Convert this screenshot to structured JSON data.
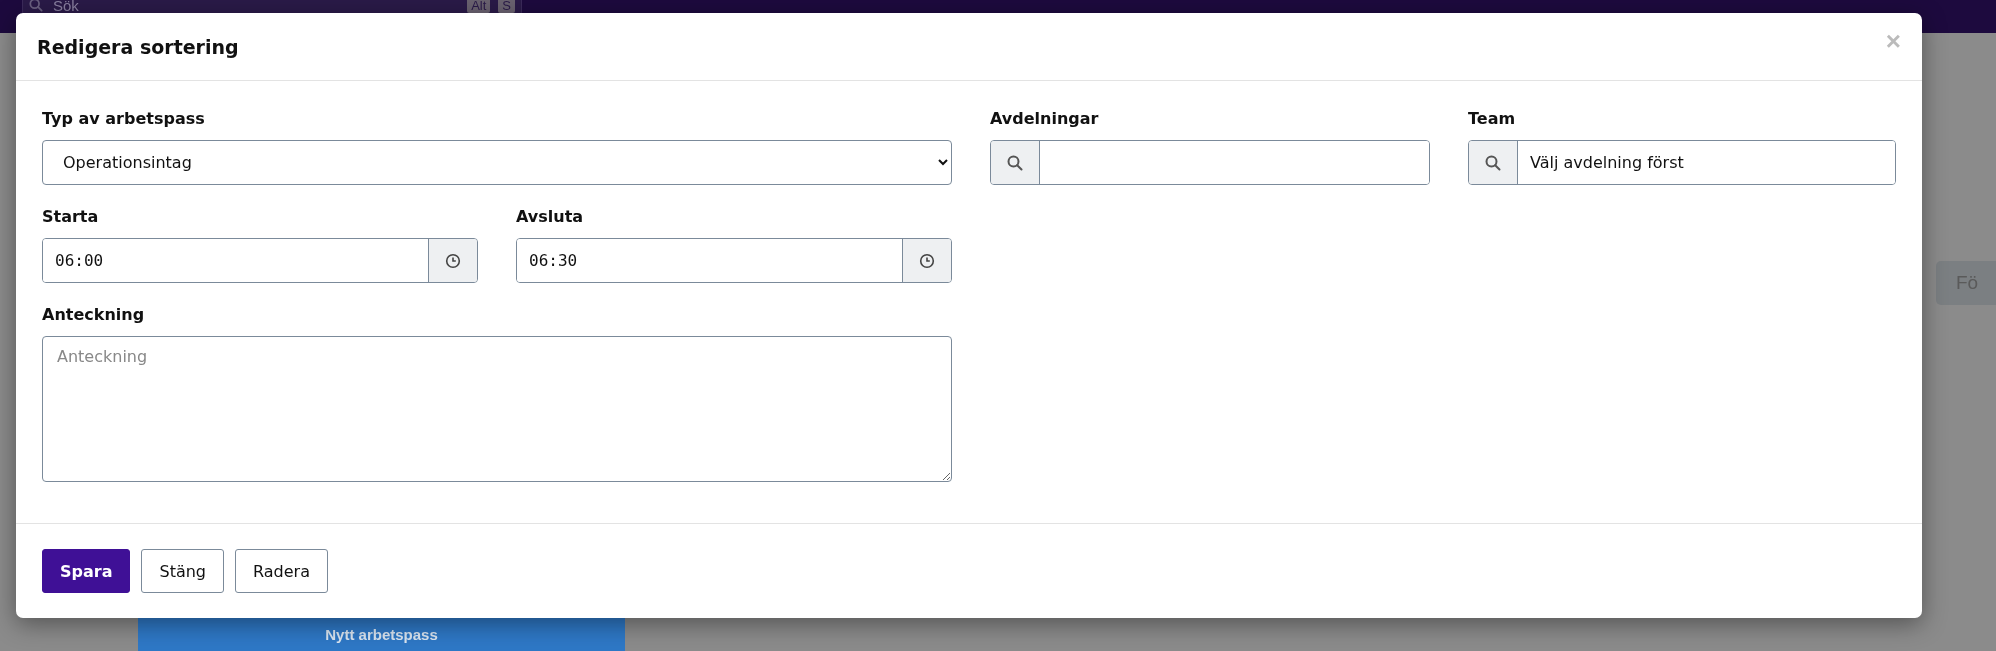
{
  "topbar": {
    "search": {
      "placeholder": "Sök"
    },
    "shortcut_keys": [
      "Alt",
      "S"
    ]
  },
  "background": {
    "side_button": "Fö",
    "shift_block": "Nytt arbetspass"
  },
  "modal": {
    "title": "Redigera sortering",
    "close": "×",
    "shift_type": {
      "label": "Typ av arbetspass",
      "value": "Operationsintag"
    },
    "departments": {
      "label": "Avdelningar"
    },
    "team": {
      "label": "Team",
      "value": "Välj avdelning först"
    },
    "start": {
      "label": "Starta",
      "value": "06:00"
    },
    "end": {
      "label": "Avsluta",
      "value": "06:30"
    },
    "note": {
      "label": "Anteckning",
      "placeholder": "Anteckning"
    },
    "buttons": [
      {
        "label": "Spara",
        "kind": "primary"
      },
      {
        "label": "Stäng",
        "kind": "secondary"
      },
      {
        "label": "Radera",
        "kind": "secondary"
      }
    ]
  }
}
